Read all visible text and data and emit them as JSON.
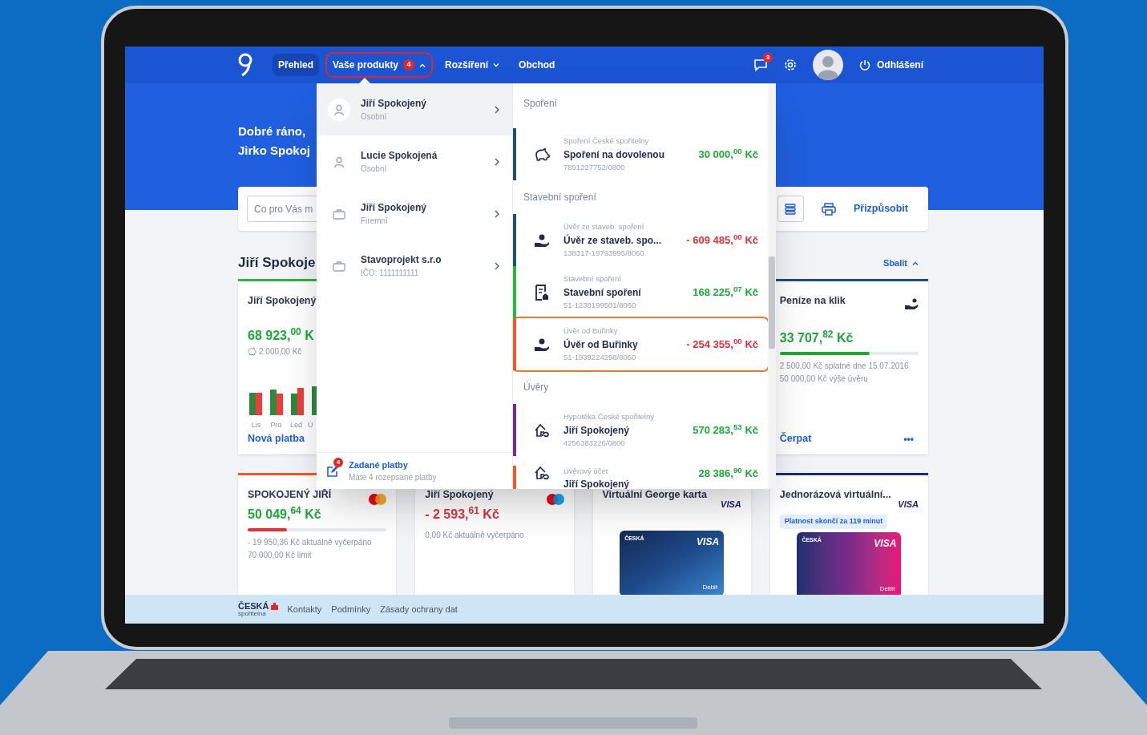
{
  "nav": {
    "items": [
      {
        "label": "Přehled",
        "kind": "link",
        "selected": true
      },
      {
        "label": "Vaše produkty",
        "kind": "dropdown",
        "selected": false,
        "open": true,
        "badge": "4"
      },
      {
        "label": "Rozšíření",
        "kind": "dropdown",
        "selected": false,
        "open": false
      },
      {
        "label": "Obchod",
        "kind": "link",
        "selected": false
      }
    ],
    "messages_badge": "3",
    "logout": "Odhlášení"
  },
  "greeting": [
    "Dobré ráno,",
    "Jirko Spokoj"
  ],
  "toolbar": {
    "placeholder": "Co pro Vás m",
    "customize": "Přizpůsobit"
  },
  "section": {
    "title": "Jiří Spokoje",
    "collapse": "Sbalit"
  },
  "rows": [
    [
      {
        "kind": "account",
        "color": "#2db34a",
        "title": "Jiří Spokojený",
        "amount": "68 923,$^{00}$ K",
        "negative": false,
        "sub": "2 000,00 Kč",
        "chart_labels": [
          "Lis",
          "Pro",
          "Led",
          "Ú"
        ],
        "action": "Nová platba"
      },
      {
        "kind": "loan",
        "color": "#1d4f7a",
        "title": "Peníze na klik",
        "amount": "33 707,$^{82}$ Kč",
        "negative": false,
        "level": 0.65,
        "lines": [
          "2 500,00 Kč splatné dne 15.07.2016",
          "50 000,00 Kč výše úvěru"
        ],
        "action": "Čerpat",
        "more": "•••"
      }
    ],
    [
      {
        "kind": "card",
        "color": "#f0592b",
        "title": "SPOKOJENÝ JIŘÍ",
        "logo": {
          "kind": "mastercard"
        },
        "amount": "50 049,$^{64}$ Kč",
        "negative": false,
        "level": 0.28,
        "lines": [
          "- 19 950,36 Kč aktuálně vyčerpáno",
          "70 000,00 Kč limit"
        ]
      },
      {
        "kind": "card",
        "color": "#ffffff",
        "title": "Jiří Spokojený",
        "logo": {
          "kind": "maestro"
        },
        "amount": "- 2 593,$^{61}$ Kč",
        "negative": true,
        "lines": [
          "0,00 Kč aktuálně vyčerpáno"
        ]
      },
      {
        "kind": "virtual",
        "color": "#ffffff",
        "title": "Virtuální George karta",
        "logo": {
          "kind": "visa",
          "text": "VISA"
        },
        "art": {
          "brand": "ČESKÁ",
          "network": "VISA",
          "type": "Debit"
        }
      },
      {
        "kind": "virtual",
        "color": "#1e2a78",
        "title": "Jednorázová virtuální...",
        "badge": "Platnost skončí za 119 minut",
        "logo": {
          "kind": "visa",
          "text": "VISA"
        },
        "art": {
          "brand": "ČESKÁ",
          "network": "VISA",
          "type": "Debit"
        }
      }
    ]
  ],
  "menu": {
    "owners": [
      {
        "name": "Jiří Spokojený",
        "type": "Osobní",
        "kind": "person",
        "selected": true
      },
      {
        "name": "Lucie Spokojená",
        "type": "Osobní",
        "kind": "person",
        "selected": false
      },
      {
        "name": "Jiří Spokojený",
        "type": "Firemní",
        "kind": "company",
        "selected": false
      },
      {
        "name": "Stavoprojekt s.r.o",
        "type": "IČO: 1111111111",
        "kind": "company",
        "selected": false
      }
    ],
    "pending": {
      "badge": "4",
      "title": "Zadané platby",
      "text": "Máte 4 rozepsané platby"
    },
    "groups": [
      {
        "title": "Spoření",
        "products": [
          {
            "kind": "savings",
            "color": "#1f4e6e",
            "label": "Spoření České spořitelny",
            "name": "Spoření na dovolenou",
            "number": "7891227752/0800",
            "amount": "30 000,$^{00}$ Kč",
            "negative": false,
            "selected": false
          }
        ]
      },
      {
        "title": "Stavební spoření",
        "products": [
          {
            "kind": "building_loan",
            "color": "#1f4e6e",
            "label": "Úvěr ze staveb. spoření",
            "name": "Úvěr ze staveb. spo...",
            "number": "138317-19793995/8060",
            "amount": "- 609 485,$^{00}$ Kč",
            "negative": true,
            "selected": false
          },
          {
            "kind": "building_savings",
            "color": "#2db34a",
            "label": "Stavební spoření",
            "name": "Stavební spoření",
            "number": "51-1238199501/8060",
            "amount": "168 225,$^{07}$ Kč",
            "negative": false,
            "selected": false
          },
          {
            "kind": "building_loan",
            "color": "#f0592b",
            "label": "Úvěr od Buřinky",
            "name": "Úvěr od Buřinky",
            "number": "51-1939224298/8060",
            "amount": "- 254 355,$^{00}$ Kč",
            "negative": true,
            "selected": true
          }
        ]
      },
      {
        "title": "Úvěry",
        "products": [
          {
            "kind": "mortgage",
            "color": "#7b2a8c",
            "label": "Hypotéka České spořitelny",
            "name": "Jiří Spokojený",
            "number": "4256383226/0800",
            "amount": "570 283,$^{53}$ Kč",
            "negative": false,
            "selected": false
          },
          {
            "kind": "mortgage",
            "color": "#f0592b",
            "label": "Úvěrový účet",
            "name": "Jiří Spokojený",
            "amount": "28 386,$^{90}$ Kč",
            "negative": false,
            "selected": false
          }
        ]
      }
    ]
  },
  "footer": {
    "brand": "ČESKÁ",
    "brand_sub": "spořitelna",
    "links": [
      "Kontakty",
      "Podmínky",
      "Zásady ochrany dat"
    ]
  }
}
